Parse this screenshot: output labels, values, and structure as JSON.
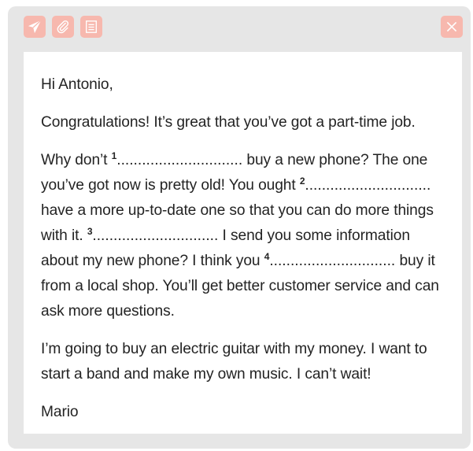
{
  "toolbar": {
    "send_icon": "paper-plane-icon",
    "attach_icon": "paperclip-icon",
    "note_icon": "note-lines-icon",
    "close_icon": "close-x-icon",
    "button_color": "#f7b8ae",
    "icon_color": "#ffffff"
  },
  "colors": {
    "window_bg": "#e6e6e6",
    "body_bg": "#ffffff",
    "text": "#232323"
  },
  "email": {
    "greeting": "Hi Antonio,",
    "para1": "Congratulations! It’s great that you’ve got a part-time job.",
    "para2": {
      "seg1": "Why don’t ",
      "gap1_num": "1",
      "gap1_dots": "..............................",
      "seg2": " buy a new phone? The one you’ve got now is pretty old! You ought ",
      "gap2_num": "2",
      "gap2_dots": "..............................",
      "seg3": " have a more up-to-date one so that you can do more things with it. ",
      "gap3_num": "3",
      "gap3_dots": "..............................",
      "seg4": " I send you some information about my new phone? I think you ",
      "gap4_num": "4",
      "gap4_dots": "..............................",
      "seg5": " buy it from a local shop. You’ll get better customer service and can ask more questions."
    },
    "para3": "I’m going to buy an electric guitar with my money. I want to start a band and make my own music. I can’t wait!",
    "signature": "Mario"
  }
}
